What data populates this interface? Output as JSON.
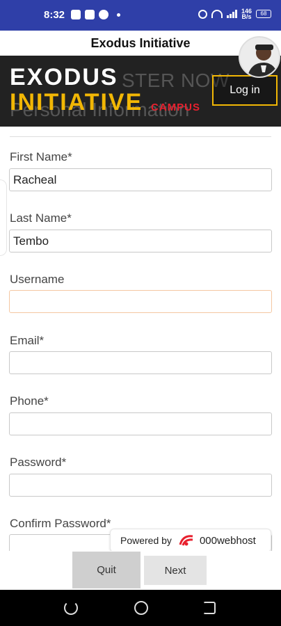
{
  "status_bar": {
    "time": "8:32",
    "network_speed_top": "146",
    "network_speed_bottom": "B/s",
    "battery": "68"
  },
  "app": {
    "title": "Exodus Initiative"
  },
  "header": {
    "logo_line1": "EXODUS",
    "logo_line2": "INITIATIVE",
    "logo_sub": "CAMPUS",
    "bg_text_1": "STER NOW",
    "bg_text_2": "Personal Information",
    "login_label": "Log in"
  },
  "form": {
    "first_name": {
      "label": "First Name*",
      "value": "Racheal"
    },
    "last_name": {
      "label": "Last Name*",
      "value": "Tembo"
    },
    "username": {
      "label": "Username",
      "value": ""
    },
    "email": {
      "label": "Email*",
      "value": ""
    },
    "phone": {
      "label": "Phone*",
      "value": ""
    },
    "password": {
      "label": "Password*",
      "value": ""
    },
    "confirm_password": {
      "label": "Confirm Password*",
      "value": ""
    }
  },
  "powered_by": {
    "text": "Powered by",
    "brand": "000webhost"
  },
  "buttons": {
    "quit": "Quit",
    "next": "Next"
  },
  "colors": {
    "status_bar": "#2f3fa8",
    "hero_bg": "#222222",
    "accent_yellow": "#f2b705",
    "accent_red": "#e8202e"
  }
}
